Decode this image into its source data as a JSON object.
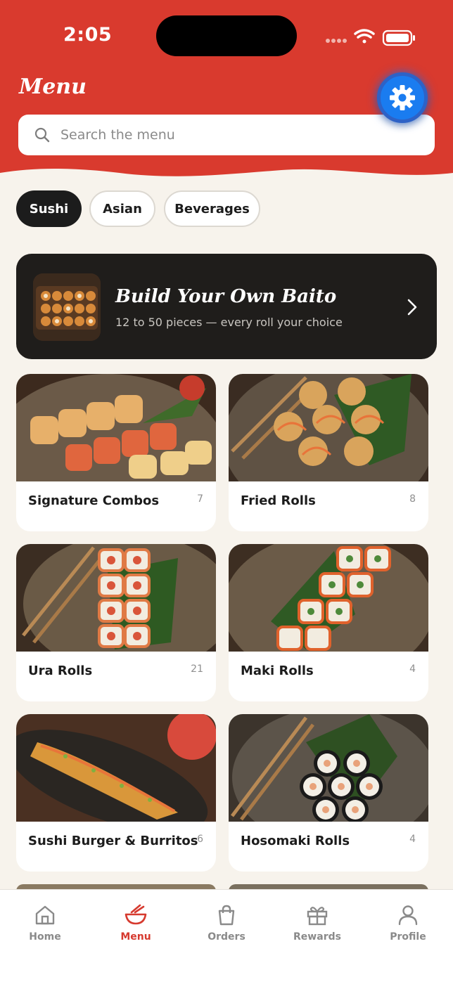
{
  "status_bar": {
    "time": "2:05"
  },
  "header": {
    "title": "Menu",
    "search_placeholder": "Search the menu",
    "accent_color": "#d93a2e"
  },
  "categories": [
    {
      "label": "Sushi",
      "active": true
    },
    {
      "label": "Asian",
      "active": false
    },
    {
      "label": "Beverages",
      "active": false
    }
  ],
  "promo": {
    "title": "Build Your Own Baito",
    "subtitle": "12 to 50 pieces — every roll your choice"
  },
  "menu_cards": [
    {
      "name": "Signature Combos",
      "count": "7"
    },
    {
      "name": "Fried Rolls",
      "count": "8"
    },
    {
      "name": "Ura Rolls",
      "count": "21"
    },
    {
      "name": "Maki Rolls",
      "count": "4"
    },
    {
      "name": "Sushi Burger & Burritos",
      "count": "6"
    },
    {
      "name": "Hosomaki Rolls",
      "count": "4"
    }
  ],
  "bottom_nav": [
    {
      "label": "Home",
      "icon": "home-icon",
      "active": false
    },
    {
      "label": "Menu",
      "icon": "bowl-icon",
      "active": true
    },
    {
      "label": "Orders",
      "icon": "bag-icon",
      "active": false
    },
    {
      "label": "Rewards",
      "icon": "gift-icon",
      "active": false
    },
    {
      "label": "Profile",
      "icon": "person-icon",
      "active": false
    }
  ]
}
